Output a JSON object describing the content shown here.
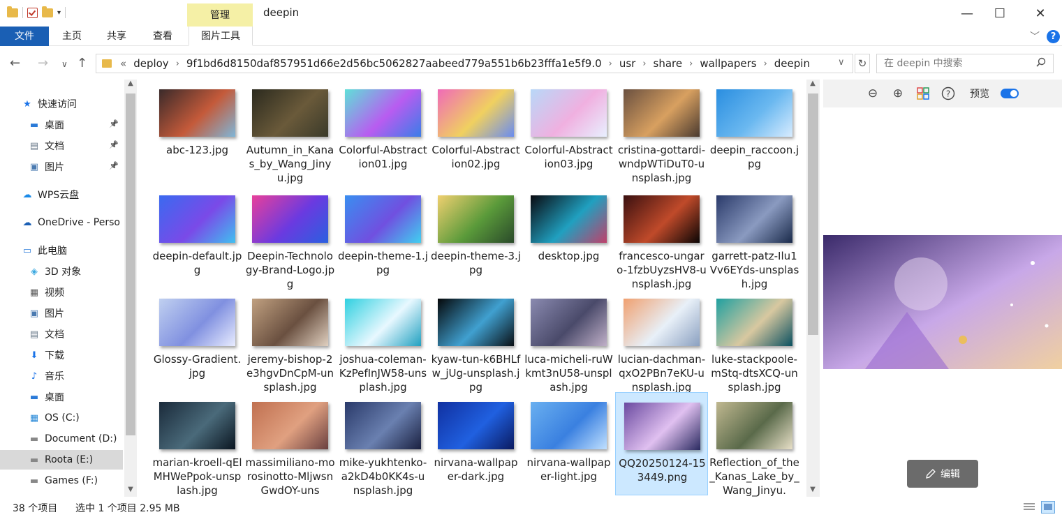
{
  "window": {
    "title": "deepin",
    "manage_tab": "管理",
    "controls": {
      "minimize": "—",
      "maximize": "☐",
      "close": "✕"
    }
  },
  "ribbon": {
    "file": "文件",
    "tabs": [
      "主页",
      "共享",
      "查看"
    ],
    "picture_tools": "图片工具",
    "help": "?"
  },
  "address": {
    "overflow": "«",
    "crumbs": [
      "deploy",
      "9f1bd6d8150daf857951d66e2d56bc5062827aabeed779a551b6b23fffa1e5f9.0",
      "usr",
      "share",
      "wallpapers",
      "deepin"
    ],
    "search_placeholder": "在 deepin 中搜索"
  },
  "sidebar": {
    "items": [
      {
        "label": "快速访问",
        "icon": "star-icon",
        "pinned": false
      },
      {
        "label": "桌面",
        "icon": "desktop-icon",
        "pinned": true
      },
      {
        "label": "文档",
        "icon": "document-icon",
        "pinned": true
      },
      {
        "label": "图片",
        "icon": "picture-icon",
        "pinned": true
      },
      {
        "label": "WPS云盘",
        "icon": "cloud-icon",
        "pinned": false
      },
      {
        "label": "OneDrive - Perso",
        "icon": "onedrive-icon",
        "pinned": false
      },
      {
        "label": "此电脑",
        "icon": "computer-icon",
        "pinned": false
      },
      {
        "label": "3D 对象",
        "icon": "3d-object-icon",
        "pinned": false
      },
      {
        "label": "视频",
        "icon": "video-icon",
        "pinned": false
      },
      {
        "label": "图片",
        "icon": "picture-icon",
        "pinned": false
      },
      {
        "label": "文档",
        "icon": "document-icon",
        "pinned": false
      },
      {
        "label": "下载",
        "icon": "download-icon",
        "pinned": false
      },
      {
        "label": "音乐",
        "icon": "music-icon",
        "pinned": false
      },
      {
        "label": "桌面",
        "icon": "desktop-icon",
        "pinned": false
      },
      {
        "label": "OS (C:)",
        "icon": "os-drive-icon",
        "pinned": false
      },
      {
        "label": "Document (D:)",
        "icon": "drive-icon",
        "pinned": false
      },
      {
        "label": "Roota (E:)",
        "icon": "drive-icon",
        "pinned": false,
        "selected": true
      },
      {
        "label": "Games (F:)",
        "icon": "drive-icon",
        "pinned": false
      }
    ]
  },
  "files": [
    {
      "name": "abc-123.jpg",
      "colors": [
        "#3a2a2a",
        "#c45a3a",
        "#7fb6d8"
      ]
    },
    {
      "name": "Autumn_in_Kanas_by_Wang_Jinyu.jpg",
      "colors": [
        "#2b2a1e",
        "#6a5a3a",
        "#3a3a2a"
      ]
    },
    {
      "name": "Colorful-Abstraction01.jpg",
      "colors": [
        "#5fe0d8",
        "#b85cf0",
        "#3a7de8"
      ]
    },
    {
      "name": "Colorful-Abstraction02.jpg",
      "colors": [
        "#f06ab8",
        "#f0d060",
        "#6a8cf0"
      ]
    },
    {
      "name": "Colorful-Abstraction03.jpg",
      "colors": [
        "#b8d8f8",
        "#f0b0e0",
        "#e8f0ff"
      ]
    },
    {
      "name": "cristina-gottardi-wndpWTiDuT0-unsplash.jpg",
      "colors": [
        "#6a5040",
        "#d8a060",
        "#4a3a30"
      ]
    },
    {
      "name": "deepin_raccoon.jpg",
      "colors": [
        "#2a8ee0",
        "#6ab8f0",
        "#d8ecff"
      ]
    },
    {
      "name": "deepin-default.jpg",
      "colors": [
        "#3a6af0",
        "#7a4ae8",
        "#40c0f0"
      ]
    },
    {
      "name": "Deepin-Technology-Brand-Logo.jpg",
      "colors": [
        "#e8409a",
        "#6a3ae0",
        "#2a60e0"
      ]
    },
    {
      "name": "deepin-theme-1.jpg",
      "colors": [
        "#3a8ef0",
        "#7050e0",
        "#40d0f0"
      ]
    },
    {
      "name": "deepin-theme-3.jpg",
      "colors": [
        "#f0d070",
        "#5a9a3a",
        "#2a4a2a"
      ]
    },
    {
      "name": "desktop.jpg",
      "colors": [
        "#0a0a10",
        "#20a0c0",
        "#c0406a"
      ]
    },
    {
      "name": "francesco-ungaro-1fzbUyzsHV8-unsplash.jpg",
      "colors": [
        "#3a1010",
        "#c04a2a",
        "#0a0505"
      ]
    },
    {
      "name": "garrett-patz-Ilu1Vv6EYds-unsplash.jpg",
      "colors": [
        "#2a3a6a",
        "#8a9ac0",
        "#1a2a4a"
      ]
    },
    {
      "name": "Glossy-Gradient.jpg",
      "colors": [
        "#c0d0f0",
        "#8090e0",
        "#e8ecff"
      ]
    },
    {
      "name": "jeremy-bishop-2e3hgvDnCpM-unsplash.jpg",
      "colors": [
        "#c0a080",
        "#6a5040",
        "#e0d0c0"
      ]
    },
    {
      "name": "joshua-coleman-KzPefInJW58-unsplash.jpg",
      "colors": [
        "#30d0e0",
        "#e8f8ff",
        "#20a0c0"
      ]
    },
    {
      "name": "kyaw-tun-k6BHLfw_jUg-unsplash.jpg",
      "colors": [
        "#05080a",
        "#40a0d0",
        "#0a1015"
      ]
    },
    {
      "name": "luca-micheli-ruWkmt3nU58-unsplash.jpg",
      "colors": [
        "#8a8ab0",
        "#4a4a6a",
        "#c0b0c8"
      ]
    },
    {
      "name": "lucian-dachman-qxO2PBn7eKU-unsplash.jpg",
      "colors": [
        "#f0a070",
        "#e8f0f8",
        "#8aa0c0"
      ]
    },
    {
      "name": "luke-stackpoole-mStq-dtsXCQ-unsplash.jpg",
      "colors": [
        "#20a0a0",
        "#d8c8a0",
        "#0a5060"
      ]
    },
    {
      "name": "marian-kroell-qElMHWePpok-unsplash.jpg",
      "colors": [
        "#1a2a3a",
        "#4a6a7a",
        "#0a1520"
      ]
    },
    {
      "name": "massimiliano-morosinotto-MljwsnGwdOY-uns",
      "colors": [
        "#c07050",
        "#e0a080",
        "#6a4040"
      ]
    },
    {
      "name": "mike-yukhtenko-a2kD4b0KK4s-unsplash.jpg",
      "colors": [
        "#2a3a6a",
        "#6a80b0",
        "#1a2040"
      ]
    },
    {
      "name": "nirvana-wallpaper-dark.jpg",
      "colors": [
        "#1030a0",
        "#2060e0",
        "#0a1a60"
      ]
    },
    {
      "name": "nirvana-wallpaper-light.jpg",
      "colors": [
        "#6ab0f0",
        "#3a80e0",
        "#c0e0ff"
      ]
    },
    {
      "name": "QQ20250124-153449.png",
      "colors": [
        "#6a4aa0",
        "#e0c0f0",
        "#2a2a60"
      ],
      "selected": true
    },
    {
      "name": "Reflection_of_the_Kanas_Lake_by_Wang_Jinyu.",
      "colors": [
        "#c0b890",
        "#5a6a4a",
        "#e8e0c8"
      ]
    }
  ],
  "preview": {
    "zoom_out_icon": "⊖",
    "zoom_in_icon": "⊕",
    "label": "预览",
    "edit_label": "编辑",
    "colors": [
      "#3a2a6a",
      "#c8a8e8",
      "#f0d0a0"
    ]
  },
  "status": {
    "count": "38 个项目",
    "selection": "选中 1 个项目  2.95 MB"
  }
}
